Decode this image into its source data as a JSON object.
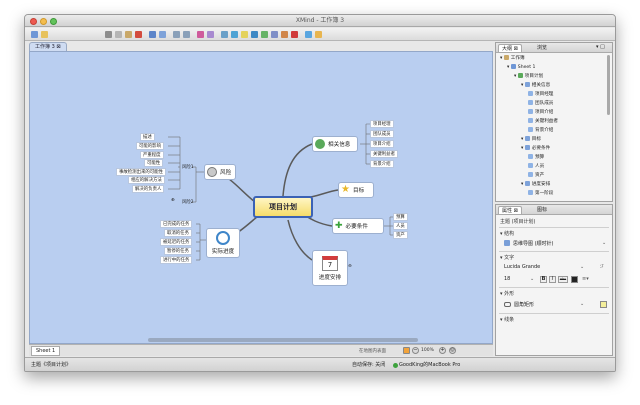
{
  "window": {
    "title": "XMind - 工作簿 3"
  },
  "editor": {
    "tab_label": "工作簿 3 ⊠"
  },
  "mindmap": {
    "central": "项目计划",
    "topics": {
      "info": "相关信息",
      "goal": "目标",
      "prereq": "必要条件",
      "schedule": "进度安排",
      "schedule_date": "7",
      "risk": "风险",
      "tracking": "实际进度"
    },
    "info_items": [
      "项目经理",
      "团队成员",
      "项目介绍",
      "关键利益者",
      "背景介绍"
    ],
    "prereq_items": [
      "预算",
      "人员",
      "资产"
    ],
    "risk_branches": [
      "风险1",
      "风险2"
    ],
    "risk1_items": [
      "描述",
      "可能的影响",
      "严重程度",
      "可能性",
      "事故检测出来的可能性",
      "相应的解决方法",
      "解决的负责人"
    ],
    "tracking_items": [
      "已完成的任务",
      "取消的任务",
      "被延迟的任务",
      "暂停的任务",
      "进行中的任务"
    ]
  },
  "sheetbar": {
    "sheet_tab": "Sheet 1",
    "hint": "在地图内表面",
    "zoom": "100%"
  },
  "statusbar": {
    "left": "主题《项目计划》",
    "autosave": "自动保存: 关闭",
    "device": "GoodKing的MacBook Pro"
  },
  "outline": {
    "tabs": [
      "大纲 ⊠",
      "浏览"
    ],
    "rows": [
      {
        "label": "工作簿",
        "level": 0,
        "selected": false
      },
      {
        "label": "Sheet 1",
        "level": 1,
        "selected": false
      },
      {
        "label": "项目计划",
        "level": 2,
        "selected": false
      },
      {
        "label": "相关信息",
        "level": 3,
        "selected": false
      },
      {
        "label": "项目经理",
        "level": 4,
        "selected": false
      },
      {
        "label": "团队成员",
        "level": 4,
        "selected": false
      },
      {
        "label": "项目介绍",
        "level": 4,
        "selected": false
      },
      {
        "label": "关键利益者",
        "level": 4,
        "selected": false
      },
      {
        "label": "背景介绍",
        "level": 4,
        "selected": false
      },
      {
        "label": "目标",
        "level": 3,
        "selected": false
      },
      {
        "label": "必要条件",
        "level": 3,
        "selected": false
      },
      {
        "label": "预算",
        "level": 4,
        "selected": false
      },
      {
        "label": "人员",
        "level": 4,
        "selected": false
      },
      {
        "label": "资产",
        "level": 4,
        "selected": false
      },
      {
        "label": "进度安排",
        "level": 3,
        "selected": false
      },
      {
        "label": "第一阶段",
        "level": 4,
        "selected": false
      }
    ]
  },
  "properties": {
    "tabs": [
      "属性 ⊠",
      "图标"
    ],
    "subject": "主题 (项目计划)",
    "structure_header": "结构",
    "structure_value": "思维导图 (顺时针)",
    "text_header": "文字",
    "font_name": "Lucida Grande",
    "font_size": "18",
    "bold": "B",
    "italic": "I",
    "strike": "abc",
    "look_header": "外形",
    "shape_value": "圆角矩形",
    "line_header": "线条"
  },
  "colors": {
    "canvas": "#b9cef0",
    "accent": "#3b62b5",
    "selection": "#3d78d8",
    "central_fill": "#f5dc6a",
    "branch": "#5a5a5a"
  },
  "icons": [
    "info-icon",
    "star-icon",
    "check-icon",
    "calendar-icon",
    "clock-icon",
    "warning-icon"
  ]
}
